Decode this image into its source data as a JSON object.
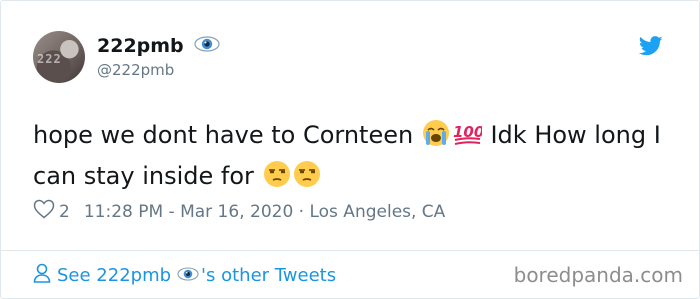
{
  "author": {
    "display_name": "222pmb",
    "handle": "@222pmb",
    "avatar_text": "222"
  },
  "tweet": {
    "text_part1": "hope we dont have to Cornteen ",
    "text_part2": " Idk How long I can stay inside for ",
    "emojis": [
      "loudly-crying-face",
      "hundred-points",
      "unamused-face",
      "unamused-face"
    ]
  },
  "meta": {
    "like_count": "2",
    "timestamp": "11:28 PM - Mar 16, 2020 · Los Angeles, CA"
  },
  "footer": {
    "link_prefix": "See 222pmb",
    "link_suffix": "'s other Tweets"
  },
  "watermark": "boredpanda.com",
  "colors": {
    "accent": "#1b95e0",
    "secondary_text": "#657786",
    "border": "#e1e8ed",
    "twitter_blue": "#1da1f2"
  }
}
